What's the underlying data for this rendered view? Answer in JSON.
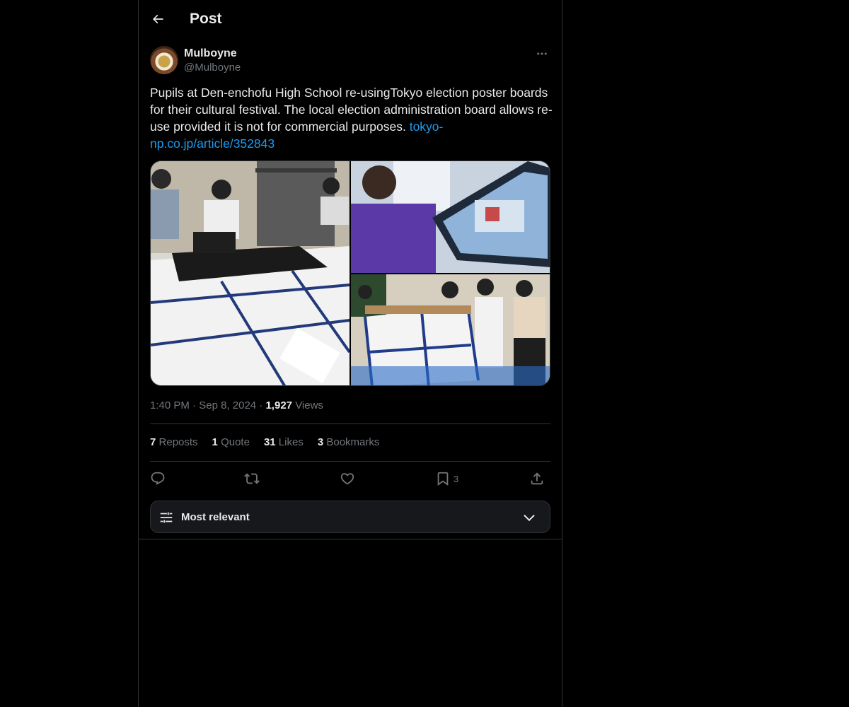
{
  "header": {
    "title": "Post",
    "back_icon": "arrow-left-icon"
  },
  "author": {
    "display_name": "Mulboyne",
    "handle": "@Mulboyne"
  },
  "post": {
    "text": "Pupils at Den-enchofu High School re-usingTokyo election poster boards for their cultural festival. The local election administration board allows re-use provided it is not for commercial purposes. ",
    "link": "tokyo-np.co.jp/article/352843",
    "time": "1:40 PM",
    "separator": "·",
    "date": "Sep 8, 2024",
    "views_count": "1,927",
    "views_label": "Views"
  },
  "stats": {
    "reposts_count": "7",
    "reposts_label": "Reposts",
    "quotes_count": "1",
    "quotes_label": "Quote",
    "likes_count": "31",
    "likes_label": "Likes",
    "bookmarks_count": "3",
    "bookmarks_label": "Bookmarks"
  },
  "actions": {
    "reply_icon": "reply-icon",
    "repost_icon": "repost-icon",
    "like_icon": "heart-icon",
    "bookmark_icon": "bookmark-icon",
    "bookmark_count": "3",
    "share_icon": "share-icon"
  },
  "sort": {
    "label": "Most relevant",
    "icon": "sliders-icon"
  },
  "colors": {
    "background": "#000000",
    "text": "#e7e9ea",
    "muted": "#71767b",
    "link": "#1d9bf0",
    "border": "#2f3336"
  }
}
